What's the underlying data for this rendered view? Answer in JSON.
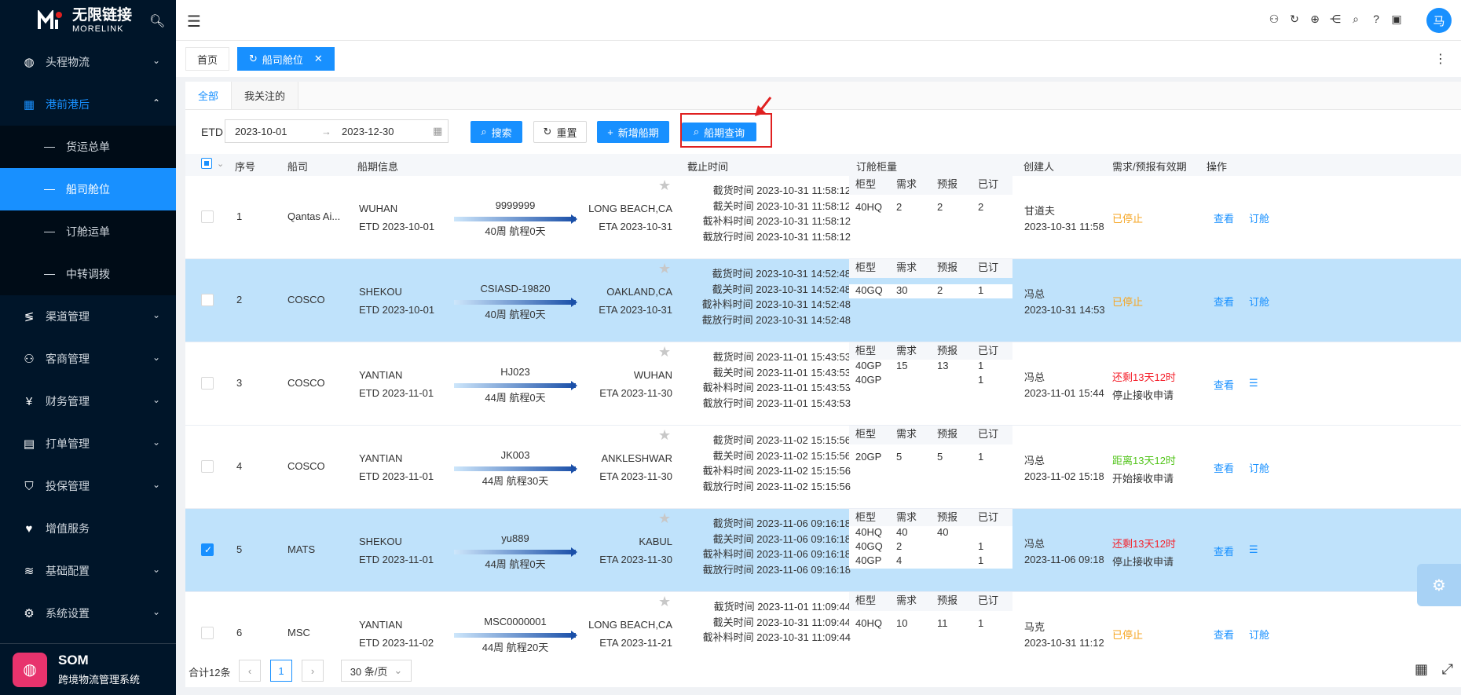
{
  "brand": {
    "name_cn": "无限链接",
    "name_en": "MORELINK"
  },
  "sidebar": {
    "items": [
      {
        "label": "头程物流",
        "icon": "globe-icon"
      },
      {
        "label": "港前港后",
        "icon": "dashboard-icon",
        "open": true
      },
      {
        "label": "渠道管理",
        "icon": "channel-icon"
      },
      {
        "label": "客商管理",
        "icon": "people-icon"
      },
      {
        "label": "财务管理",
        "icon": "yen-icon"
      },
      {
        "label": "打单管理",
        "icon": "print-icon"
      },
      {
        "label": "投保管理",
        "icon": "insurance-icon"
      },
      {
        "label": "增值服务",
        "icon": "heart-icon"
      },
      {
        "label": "基础配置",
        "icon": "layers-icon"
      },
      {
        "label": "系统设置",
        "icon": "gear-icon"
      }
    ],
    "sub_items": [
      {
        "label": "货运总单"
      },
      {
        "label": "船司舱位",
        "active": true
      },
      {
        "label": "订舱运单"
      },
      {
        "label": "中转调拨"
      }
    ],
    "system": {
      "title": "SOM",
      "subtitle": "跨境物流管理系统"
    }
  },
  "header": {
    "avatar_text": "马"
  },
  "tabs": {
    "home": "首页",
    "current": "船司舱位"
  },
  "subtabs": {
    "all": "全部",
    "followed": "我关注的"
  },
  "filter": {
    "etd_label": "ETD",
    "date_start": "2023-10-01",
    "date_end": "2023-12-30",
    "search": "搜索",
    "reset": "重置",
    "add": "新增船期",
    "query": "船期查询"
  },
  "table": {
    "headers": {
      "seq": "序号",
      "carrier": "船司",
      "schedule": "船期信息",
      "cutoff": "截止时间",
      "booking": "订舱柜量",
      "creator": "创建人",
      "validity": "需求/预报有效期",
      "ops": "操作"
    },
    "cont_headers": {
      "type": "柜型",
      "demand": "需求",
      "forecast": "预报",
      "booked": "已订"
    },
    "cut_labels": {
      "cargo": "截货时间",
      "customs": "截关时间",
      "si": "截补料时间",
      "release": "截放行时间"
    },
    "view": "查看",
    "book": "订舱",
    "rows": [
      {
        "seq": "1",
        "carrier": "Qantas Ai...",
        "pol": "WUHAN",
        "etd": "ETD 2023-10-01",
        "vessel": "9999999",
        "voyage": "40周 航程0天",
        "pod": "LONG BEACH,CA",
        "eta": "ETA 2023-10-31",
        "cuts": [
          "2023-10-31 11:58:12",
          "2023-10-31 11:58:12",
          "2023-10-31 11:58:12",
          "2023-10-31 11:58:12"
        ],
        "containers": [
          {
            "type": "40HQ",
            "demand": "2",
            "forecast": "2",
            "booked": "2"
          }
        ],
        "creator": "甘道夫",
        "created": "2023-10-31 11:58",
        "status": "已停止",
        "status_kind": "stop",
        "status2": "",
        "op2": "订舱",
        "checked": false,
        "highlight": false
      },
      {
        "seq": "2",
        "carrier": "COSCO",
        "pol": "SHEKOU",
        "etd": "ETD 2023-10-01",
        "vessel": "CSIASD-19820",
        "voyage": "40周 航程0天",
        "pod": "OAKLAND,CA",
        "eta": "ETA 2023-10-31",
        "cuts": [
          "2023-10-31 14:52:48",
          "2023-10-31 14:52:48",
          "2023-10-31 14:52:48",
          "2023-10-31 14:52:48"
        ],
        "containers": [
          {
            "type": "40GQ",
            "demand": "30",
            "forecast": "2",
            "booked": "1"
          }
        ],
        "creator": "冯总",
        "created": "2023-10-31 14:53",
        "status": "已停止",
        "status_kind": "stop",
        "status2": "",
        "op2": "订舱",
        "checked": false,
        "highlight": true
      },
      {
        "seq": "3",
        "carrier": "COSCO",
        "pol": "YANTIAN",
        "etd": "ETD 2023-11-01",
        "vessel": "HJ023",
        "voyage": "44周 航程0天",
        "pod": "WUHAN",
        "eta": "ETA 2023-11-30",
        "cuts": [
          "2023-11-01 15:43:53",
          "2023-11-01 15:43:53",
          "2023-11-01 15:43:53",
          "2023-11-01 15:43:53"
        ],
        "containers": [
          {
            "type": "40GP",
            "demand": "15",
            "forecast": "13",
            "booked": "1"
          },
          {
            "type": "40GP",
            "demand": "",
            "forecast": "",
            "booked": "1"
          }
        ],
        "creator": "冯总",
        "created": "2023-11-01 15:44",
        "status": "还剩13天12时",
        "status_kind": "red",
        "status2": "停止接收申请",
        "op2": "☰",
        "checked": false,
        "highlight": false
      },
      {
        "seq": "4",
        "carrier": "COSCO",
        "pol": "YANTIAN",
        "etd": "ETD 2023-11-01",
        "vessel": "JK003",
        "voyage": "44周 航程30天",
        "pod": "ANKLESHWAR",
        "eta": "ETA 2023-11-30",
        "cuts": [
          "2023-11-02 15:15:56",
          "2023-11-02 15:15:56",
          "2023-11-02 15:15:56",
          "2023-11-02 15:15:56"
        ],
        "containers": [
          {
            "type": "20GP",
            "demand": "5",
            "forecast": "5",
            "booked": "1"
          }
        ],
        "creator": "冯总",
        "created": "2023-11-02 15:18",
        "status": "距离13天12时",
        "status_kind": "green",
        "status2": "开始接收申请",
        "op2": "订舱",
        "checked": false,
        "highlight": false
      },
      {
        "seq": "5",
        "carrier": "MATS",
        "pol": "SHEKOU",
        "etd": "ETD 2023-11-01",
        "vessel": "yu889",
        "voyage": "44周 航程0天",
        "pod": "KABUL",
        "eta": "ETA 2023-11-30",
        "cuts": [
          "2023-11-06 09:16:18",
          "2023-11-06 09:16:18",
          "2023-11-06 09:16:18",
          "2023-11-06 09:16:18"
        ],
        "containers": [
          {
            "type": "40HQ",
            "demand": "40",
            "forecast": "40",
            "booked": ""
          },
          {
            "type": "40GQ",
            "demand": "2",
            "forecast": "",
            "booked": "1"
          },
          {
            "type": "40GP",
            "demand": "4",
            "forecast": "",
            "booked": "1"
          }
        ],
        "creator": "冯总",
        "created": "2023-11-06 09:18",
        "status": "还剩13天12时",
        "status_kind": "red",
        "status2": "停止接收申请",
        "op2": "☰",
        "checked": true,
        "highlight": true
      },
      {
        "seq": "6",
        "carrier": "MSC",
        "pol": "YANTIAN",
        "etd": "ETD 2023-11-02",
        "vessel": "MSC0000001",
        "voyage": "44周 航程20天",
        "pod": "LONG BEACH,CA",
        "eta": "ETA 2023-11-21",
        "cuts": [
          "2023-11-01 11:09:44",
          "2023-10-31 11:09:44",
          "2023-10-31 11:09:44",
          ""
        ],
        "containers": [
          {
            "type": "40HQ",
            "demand": "10",
            "forecast": "11",
            "booked": "1"
          }
        ],
        "creator": "马克",
        "created": "2023-10-31 11:12",
        "status": "已停止",
        "status_kind": "stop",
        "status2": "",
        "op2": "订舱",
        "checked": false,
        "highlight": false
      }
    ]
  },
  "footer": {
    "total": "合计12条",
    "page": "1",
    "page_size": "30 条/页"
  },
  "colors": {
    "primary": "#1890ff",
    "sidebar_bg": "#001529",
    "selected_row": "#bfe2fb",
    "alert": "#e02020"
  }
}
